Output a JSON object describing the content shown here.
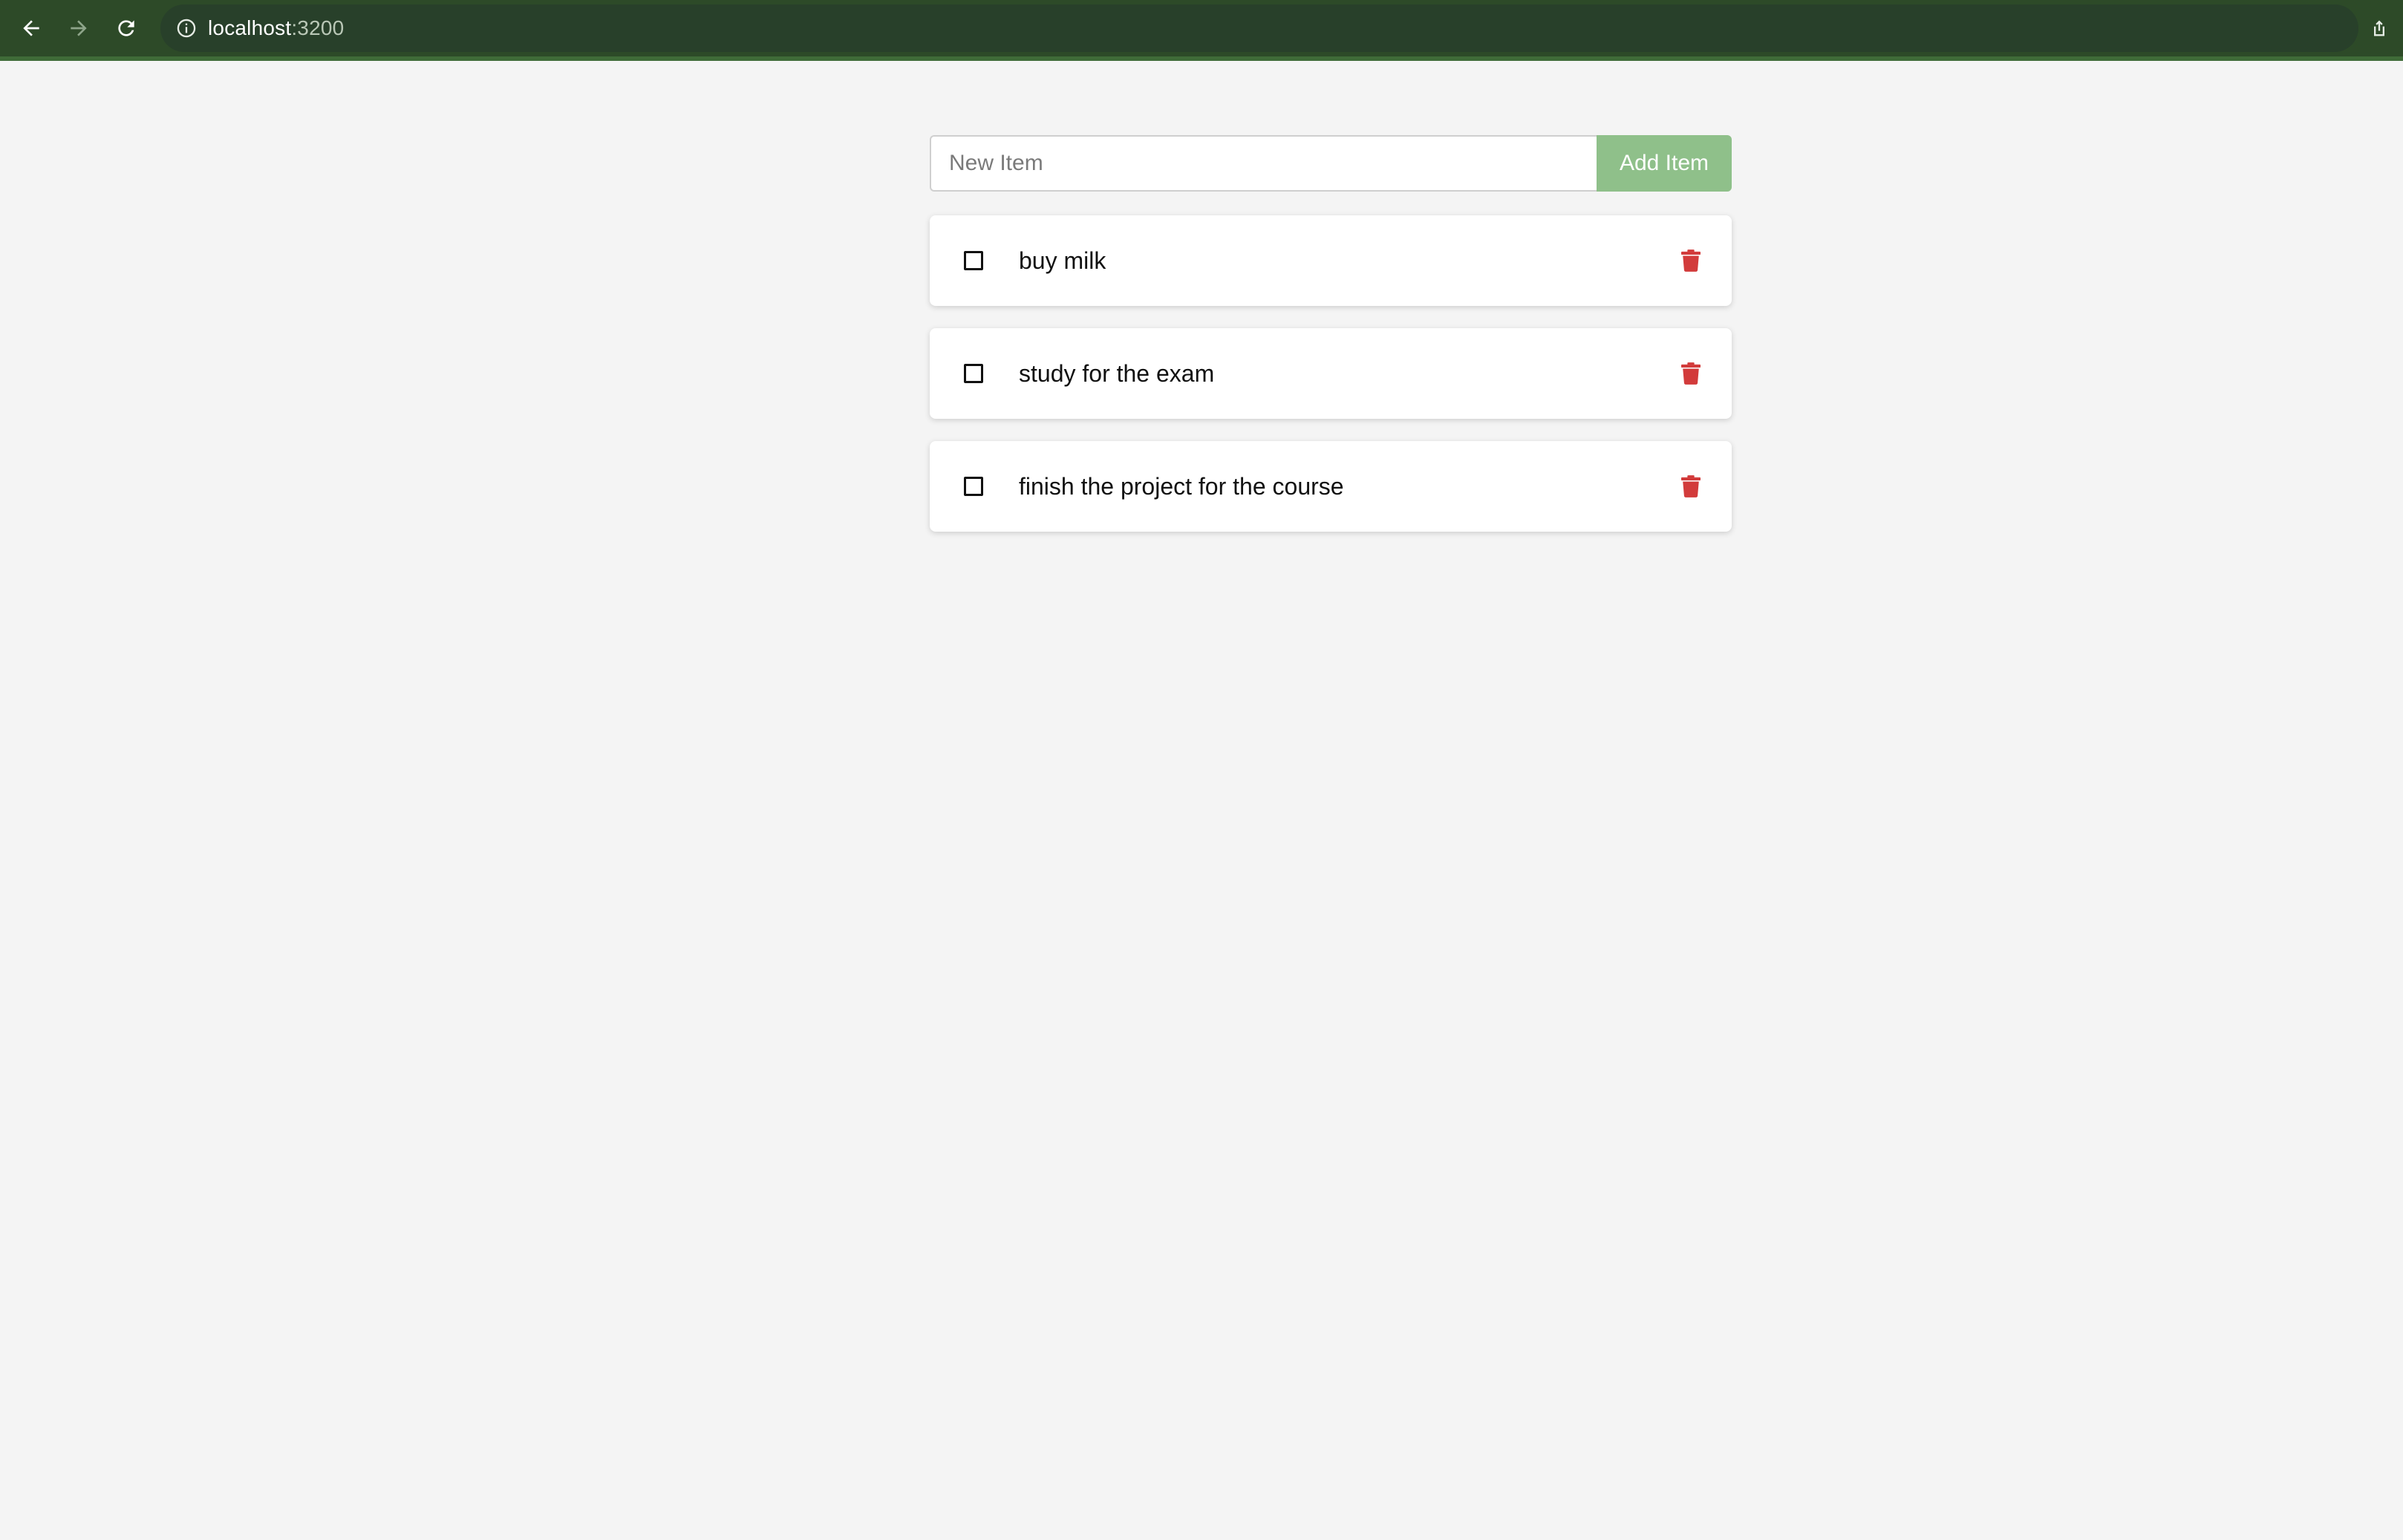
{
  "browser": {
    "url_host": "localhost",
    "url_port": ":3200",
    "icons": {
      "back": "arrow-left-icon",
      "forward": "arrow-right-icon",
      "reload": "reload-icon",
      "info": "info-icon",
      "share": "share-icon"
    },
    "colors": {
      "toolbar": "#2d4a28",
      "accent": "#3f6b38"
    }
  },
  "form": {
    "input_value": "",
    "input_placeholder": "New Item",
    "add_label": "Add Item"
  },
  "todos": [
    {
      "text": "buy milk",
      "checked": false
    },
    {
      "text": "study for the exam",
      "checked": false
    },
    {
      "text": "finish the project for the course",
      "checked": false
    }
  ],
  "colors": {
    "add_button": "#8fc08a",
    "delete_icon": "#d23b3b",
    "background": "#f4f4f4"
  }
}
